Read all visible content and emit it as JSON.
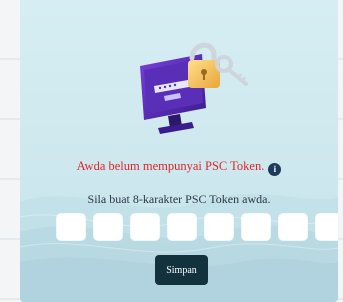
{
  "warning": {
    "text": "Awda belum mempunyai PSC Token.",
    "icon": "info-icon",
    "icon_glyph": "i",
    "color": "#e0262a"
  },
  "hint": {
    "text": "Sila buat 8-karakter PSC Token awda."
  },
  "pin_inputs": [
    {
      "value": ""
    },
    {
      "value": ""
    },
    {
      "value": ""
    },
    {
      "value": ""
    },
    {
      "value": ""
    },
    {
      "value": ""
    },
    {
      "value": ""
    },
    {
      "value": ""
    }
  ],
  "save_button": {
    "label": "Simpan",
    "color": "#12323d"
  },
  "illustration": {
    "icon": "monitor-padlock-key-icon",
    "screen_label": "LOGIN"
  }
}
